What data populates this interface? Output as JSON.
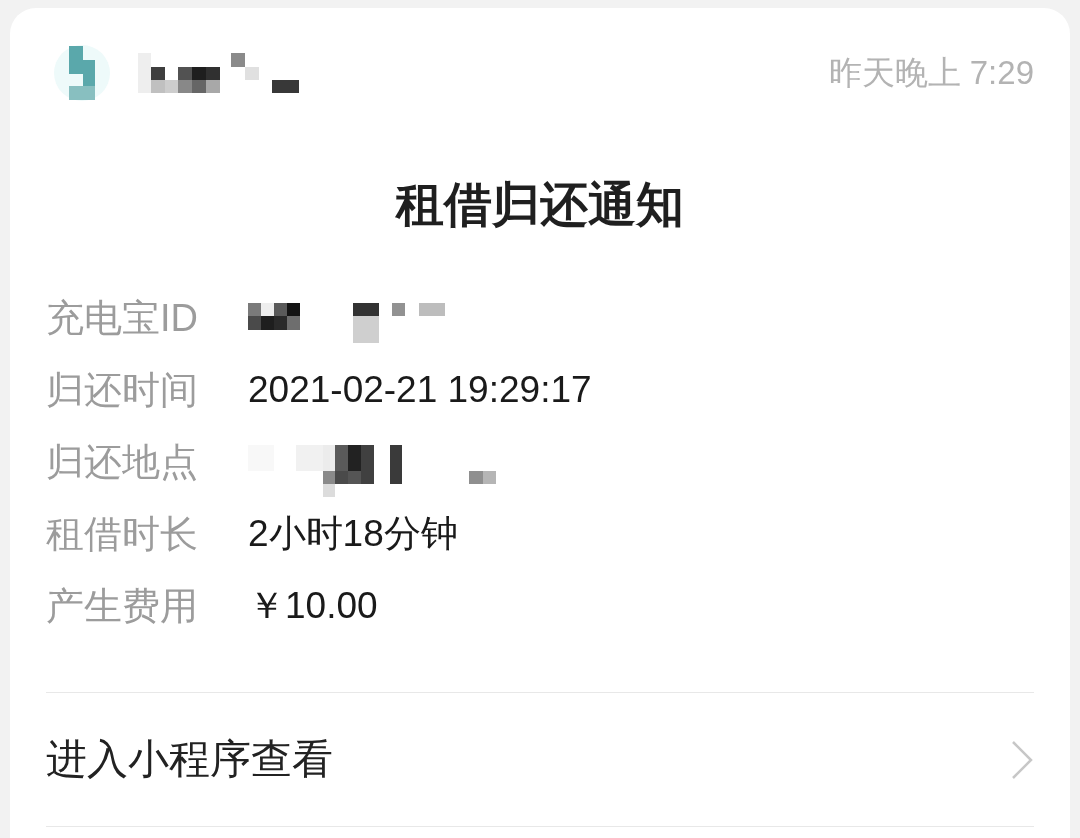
{
  "header": {
    "time": "昨天晚上 7:29"
  },
  "title": "租借归还通知",
  "fields": [
    {
      "label": "充电宝ID",
      "kind": "redacted"
    },
    {
      "label": "归还时间",
      "kind": "text",
      "value": "2021-02-21 19:29:17"
    },
    {
      "label": "归还地点",
      "kind": "redacted"
    },
    {
      "label": "租借时长",
      "kind": "text",
      "value": "2小时18分钟"
    },
    {
      "label": "产生费用",
      "kind": "text",
      "value": "￥10.00"
    }
  ],
  "link": {
    "label": "进入小程序查看"
  }
}
